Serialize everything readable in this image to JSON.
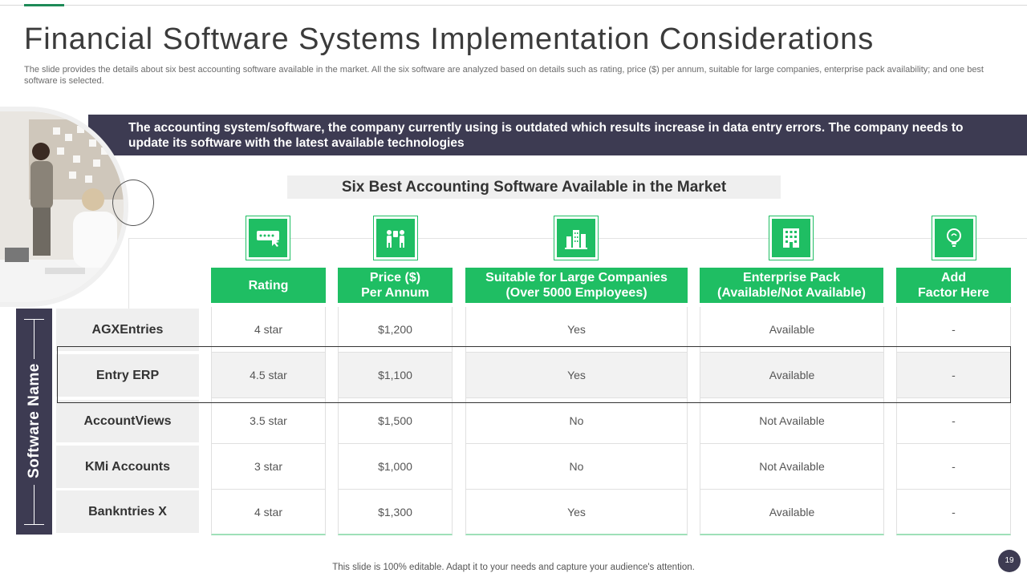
{
  "slide": {
    "title": "Financial Software Systems Implementation Considerations",
    "subtitle": "The slide provides the details about six best accounting software available in the market. All the six software are analyzed based on details such as rating, price ($) per annum, suitable for large companies, enterprise pack availability; and one best software is selected.",
    "banner": "The accounting system/software,  the company currently using is outdated which results increase in data entry errors. The company needs to update its software with the latest available technologies",
    "table_title": "Six Best Accounting Software Available in the Market",
    "side_label": "Software Name",
    "footer": "This slide is 100% editable. Adapt it to your needs and capture your audience's attention.",
    "page_number": "19"
  },
  "columns": [
    {
      "label": "Rating",
      "icon": "rating-keyboard-icon"
    },
    {
      "label": "Price ($)\nPer Annum",
      "icon": "people-money-icon"
    },
    {
      "label": "Suitable for Large Companies\n(Over 5000 Employees)",
      "icon": "city-buildings-icon"
    },
    {
      "label": "Enterprise Pack\n(Available/Not Available)",
      "icon": "office-building-icon"
    },
    {
      "label": "Add\nFactor Here",
      "icon": "lightbulb-icon"
    }
  ],
  "rows": [
    {
      "name": "AGXEntries",
      "values": [
        "4 star",
        "$1,200",
        "Yes",
        "Available",
        "-"
      ]
    },
    {
      "name": "Entry ERP",
      "values": [
        "4.5 star",
        "$1,100",
        "Yes",
        "Available",
        "-"
      ]
    },
    {
      "name": "AccountViews",
      "values": [
        "3.5 star",
        "$1,500",
        "No",
        "Not Available",
        "-"
      ]
    },
    {
      "name": "KMi Accounts",
      "values": [
        "3 star",
        "$1,000",
        "No",
        "Not Available",
        "-"
      ]
    },
    {
      "name": "Bankntries X",
      "values": [
        "4 star",
        "$1,300",
        "Yes",
        "Available",
        "-"
      ]
    }
  ],
  "colors": {
    "accent": "#1fbe63",
    "dark": "#3d3b52"
  }
}
